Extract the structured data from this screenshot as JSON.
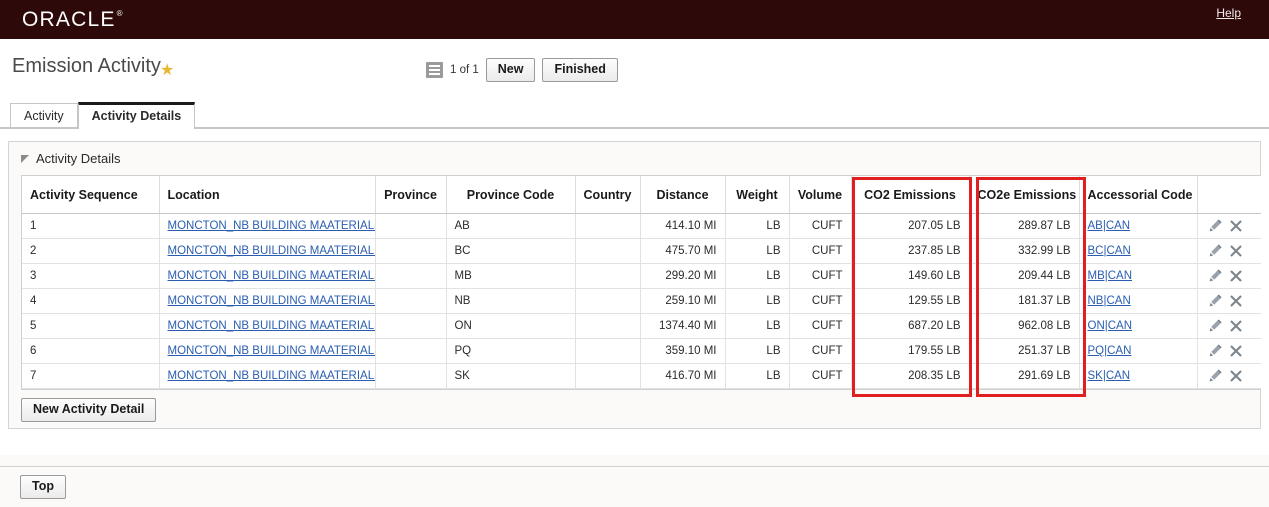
{
  "brand": {
    "logo_text": "ORACLE",
    "trademark": "®",
    "help_label": "Help"
  },
  "header": {
    "page_title": "Emission Activity",
    "favorite_icon": "star-icon",
    "list_icon": "list-icon",
    "page_count": "1 of 1",
    "new_button": "New",
    "finished_button": "Finished"
  },
  "tabs": [
    {
      "label": "Activity",
      "active": false
    },
    {
      "label": "Activity Details",
      "active": true
    }
  ],
  "section": {
    "title": "Activity Details",
    "collapse_icon": "collapse-triangle-icon",
    "new_detail_button": "New Activity Detail"
  },
  "table": {
    "columns": [
      "Activity Sequence",
      "Location",
      "Province",
      "Province Code",
      "Country",
      "Distance",
      "Weight",
      "Volume",
      "CO2 Emissions",
      "CO2e Emissions",
      "Accessorial Code",
      ""
    ],
    "rows": [
      {
        "seq": "1",
        "location": "MONCTON_NB BUILDING MAATERIALS",
        "province": "",
        "province_code": "AB",
        "country": "",
        "distance": "414.10 MI",
        "weight": "LB",
        "volume": "CUFT",
        "co2": "207.05 LB",
        "co2e": "289.87 LB",
        "accessorial": "AB|CAN"
      },
      {
        "seq": "2",
        "location": "MONCTON_NB BUILDING MAATERIALS",
        "province": "",
        "province_code": "BC",
        "country": "",
        "distance": "475.70 MI",
        "weight": "LB",
        "volume": "CUFT",
        "co2": "237.85 LB",
        "co2e": "332.99 LB",
        "accessorial": "BC|CAN"
      },
      {
        "seq": "3",
        "location": "MONCTON_NB BUILDING MAATERIALS",
        "province": "",
        "province_code": "MB",
        "country": "",
        "distance": "299.20 MI",
        "weight": "LB",
        "volume": "CUFT",
        "co2": "149.60 LB",
        "co2e": "209.44 LB",
        "accessorial": "MB|CAN"
      },
      {
        "seq": "4",
        "location": "MONCTON_NB BUILDING MAATERIALS",
        "province": "",
        "province_code": "NB",
        "country": "",
        "distance": "259.10 MI",
        "weight": "LB",
        "volume": "CUFT",
        "co2": "129.55 LB",
        "co2e": "181.37 LB",
        "accessorial": "NB|CAN"
      },
      {
        "seq": "5",
        "location": "MONCTON_NB BUILDING MAATERIALS",
        "province": "",
        "province_code": "ON",
        "country": "",
        "distance": "1374.40 MI",
        "weight": "LB",
        "volume": "CUFT",
        "co2": "687.20 LB",
        "co2e": "962.08 LB",
        "accessorial": "ON|CAN"
      },
      {
        "seq": "6",
        "location": "MONCTON_NB BUILDING MAATERIALS",
        "province": "",
        "province_code": "PQ",
        "country": "",
        "distance": "359.10 MI",
        "weight": "LB",
        "volume": "CUFT",
        "co2": "179.55 LB",
        "co2e": "251.37 LB",
        "accessorial": "PQ|CAN"
      },
      {
        "seq": "7",
        "location": "MONCTON_NB BUILDING MAATERIALS",
        "province": "",
        "province_code": "SK",
        "country": "",
        "distance": "416.70 MI",
        "weight": "LB",
        "volume": "CUFT",
        "co2": "208.35 LB",
        "co2e": "291.69 LB",
        "accessorial": "SK|CAN"
      }
    ],
    "row_action_icons": [
      "edit-pencil-icon",
      "delete-x-icon"
    ]
  },
  "annotations": [
    {
      "name": "co2-emissions-highlight",
      "color": "#e02020"
    },
    {
      "name": "co2e-emissions-highlight",
      "color": "#e02020"
    }
  ],
  "footer": {
    "top_button": "Top"
  }
}
